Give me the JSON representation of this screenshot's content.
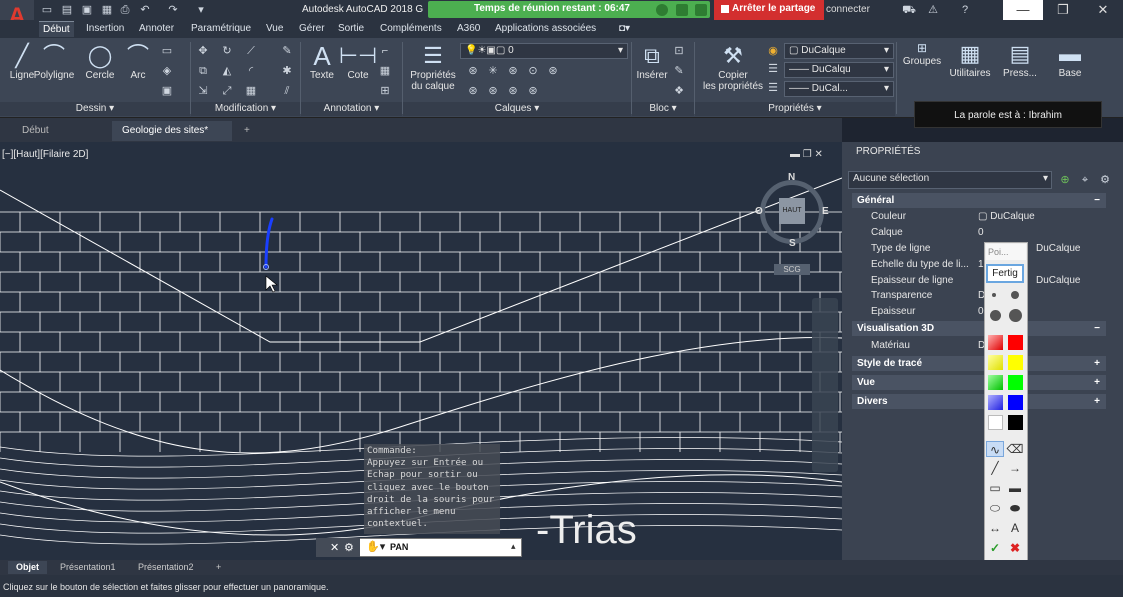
{
  "window": {
    "title": "Autodesk AutoCAD 2018",
    "title_suffix": "G",
    "connect_label": "connecter"
  },
  "meeting": {
    "time_text": "Temps de réunion restant : 06:47",
    "stop_share": "Arrêter le partage",
    "speaker": "La parole est à : Ibrahim"
  },
  "quick_access": {
    "icons": [
      "folder-new-icon",
      "folder-open-icon",
      "save-icon",
      "save-as-icon",
      "print-icon",
      "undo-icon",
      "redo-icon",
      "more-icon"
    ]
  },
  "ribbon_tabs": [
    "Début",
    "Insertion",
    "Annoter",
    "Paramétrique",
    "Vue",
    "Gérer",
    "Sortie",
    "Compléments",
    "A360",
    "Applications associées"
  ],
  "panels": {
    "dessin": {
      "label": "Dessin",
      "tools": [
        "Ligne",
        "Polyligne",
        "Cercle",
        "Arc"
      ]
    },
    "modification": {
      "label": "Modification"
    },
    "annotation": {
      "label": "Annotation",
      "tools": [
        "Texte",
        "Cote"
      ]
    },
    "calques": {
      "label": "Calques",
      "tool": "Propriétés",
      "tool2": "du calque",
      "layer_value": "0"
    },
    "bloc": {
      "label": "Bloc",
      "tool": "Insérer"
    },
    "proprietes": {
      "label": "Propriétés",
      "tool": "Copier",
      "tool2": "les propriétés",
      "color": "DuCalque",
      "linetype": "DuCalqu",
      "lineweight": "DuCal..."
    },
    "groupes": {
      "label": "Groupes"
    },
    "utilitaires": {
      "label": "Utilitaires"
    },
    "presse": {
      "label": "Press..."
    },
    "base": {
      "label": "Base"
    }
  },
  "doc_tabs": [
    "Début",
    "Geologie des sites*"
  ],
  "viewport": {
    "label": "[−][Haut][Filaire 2D]",
    "compass": {
      "n": "N",
      "s": "S",
      "e": "E",
      "o": "O",
      "face": "HAUT",
      "scg": "SCG"
    },
    "big_text": "Trias",
    "big_text_prefix": "-"
  },
  "command": {
    "title": "Commande:",
    "prompt": "Appuyez sur Entrée ou Echap pour sortir ou cliquez avec le bouton droit de la souris pour afficher le menu contextuel.",
    "current": "PAN"
  },
  "layout_tabs": [
    "Objet",
    "Présentation1",
    "Présentation2"
  ],
  "status_text": "Cliquez sur le bouton de sélection et faites glisser pour effectuer un panoramique.",
  "properties": {
    "title": "PROPRIÉTÉS",
    "selection": "Aucune sélection",
    "general": {
      "label": "Général",
      "rows": [
        {
          "label": "Couleur",
          "value": "DuCalque"
        },
        {
          "label": "Calque",
          "value": "0"
        },
        {
          "label": "Type de ligne",
          "value": "DuCalque"
        },
        {
          "label": "Echelle du type de li...",
          "value": "1"
        },
        {
          "label": "Epaisseur de ligne",
          "value": "DuCalque"
        },
        {
          "label": "Transparence",
          "value": "D"
        },
        {
          "label": "Epaisseur",
          "value": "0"
        }
      ]
    },
    "vis3d": {
      "label": "Visualisation 3D",
      "rows": [
        {
          "label": "Matériau",
          "value": "D"
        }
      ]
    },
    "sections": [
      "Style de tracé",
      "Vue",
      "Divers"
    ]
  },
  "annot_toolbar": {
    "field": "Poi...",
    "done": "Fertig"
  },
  "colors": {
    "accent": "#e03a2f",
    "meeting_green": "#4caf50",
    "stop_red": "#d32f2f",
    "pen_blue": "#1a3fff"
  }
}
